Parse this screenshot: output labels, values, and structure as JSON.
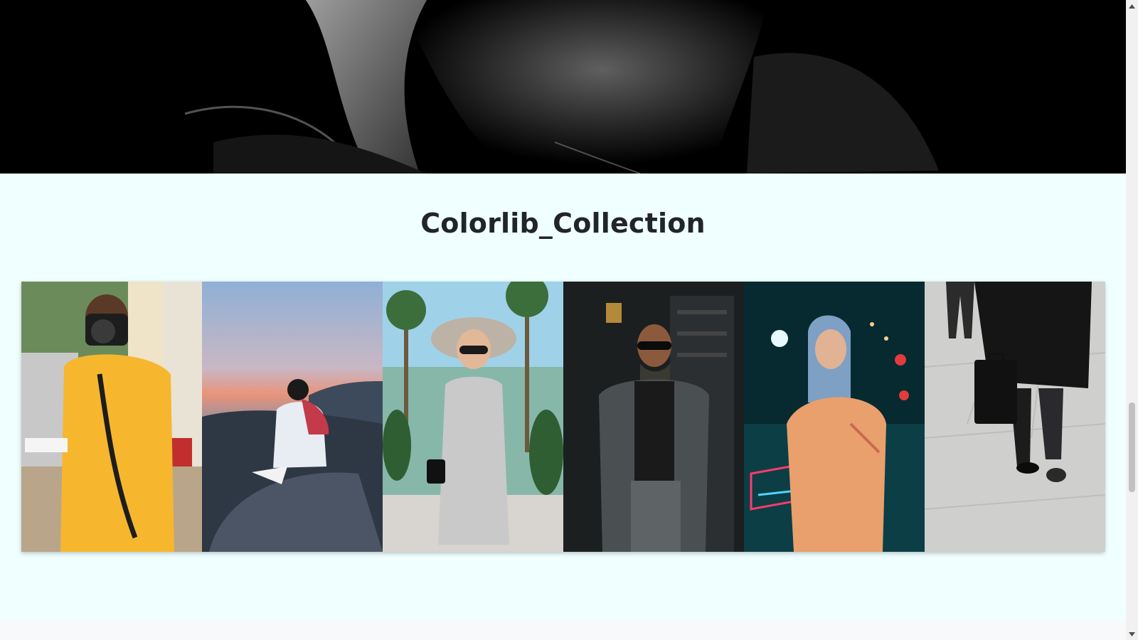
{
  "collection": {
    "title": "Colorlib_Collection"
  },
  "gallery": {
    "items": [
      {
        "icon": "photographer-with-camera-image",
        "palette": [
          "#efe3c8",
          "#f6b72f",
          "#3a2a20"
        ]
      },
      {
        "icon": "man-on-cliff-at-sunset-image",
        "palette": [
          "#8fb0d6",
          "#3a4656",
          "#c33a4a"
        ]
      },
      {
        "icon": "woman-in-hat-with-palm-trees-image",
        "palette": [
          "#9fd2e8",
          "#c9c9c9",
          "#3b6e3a"
        ]
      },
      {
        "icon": "man-in-gray-coat-image",
        "palette": [
          "#1c1f20",
          "#4a4f52",
          "#2d2a28"
        ]
      },
      {
        "icon": "woman-in-hoodie-neon-street-image",
        "palette": [
          "#062a30",
          "#e9a06d",
          "#ff3b6a"
        ]
      },
      {
        "icon": "man-with-briefcase-walking-image",
        "palette": [
          "#cfcfcd",
          "#151515",
          "#9a9a98"
        ]
      }
    ]
  },
  "scrollbar": {
    "position_fraction": 0.68
  }
}
